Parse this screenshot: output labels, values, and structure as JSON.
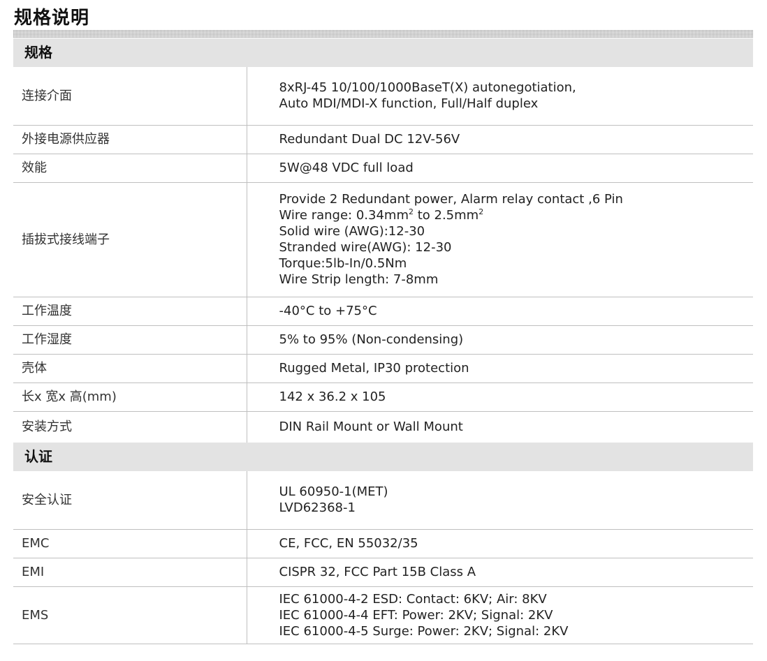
{
  "page_title": "规格说明",
  "sections": {
    "spec": {
      "title": "规格",
      "rows": [
        {
          "label": "连接介面",
          "lines": [
            "8xRJ-45 10/100/1000BaseT(X) autonegotiation,",
            "Auto MDI/MDI-X function, Full/Half duplex"
          ]
        },
        {
          "label": "外接电源供应器",
          "lines": [
            "Redundant Dual DC 12V-56V"
          ]
        },
        {
          "label": "效能",
          "lines": [
            "5W@48 VDC full load"
          ]
        },
        {
          "label": "插拔式接线端子",
          "lines": [
            "Provide 2 Redundant power, Alarm relay contact ,6 Pin"
          ],
          "wire_range": {
            "prefix": "Wire range: 0.34mm",
            "sup1": "2",
            "middle": " to 2.5mm",
            "sup2": "2"
          },
          "more_lines": [
            "Solid wire (AWG):12-30",
            "Stranded wire(AWG): 12-30",
            "Torque:5lb-In/0.5Nm",
            "Wire Strip length: 7-8mm"
          ]
        },
        {
          "label": "工作温度",
          "lines": [
            "-40°C to +75°C"
          ]
        },
        {
          "label": "工作湿度",
          "lines": [
            "5% to 95% (Non-condensing)"
          ]
        },
        {
          "label": "壳体",
          "lines": [
            "Rugged Metal, IP30 protection"
          ]
        },
        {
          "label": "长x 宽x 高(mm)",
          "lines": [
            "142 x 36.2 x 105"
          ]
        },
        {
          "label": "安装方式",
          "lines": [
            "DIN Rail Mount or Wall Mount"
          ]
        }
      ]
    },
    "cert": {
      "title": "认证",
      "rows": [
        {
          "label": "安全认证",
          "lines": [
            "UL 60950-1(MET)",
            "LVD62368-1"
          ]
        },
        {
          "label": "EMC",
          "lines": [
            "CE, FCC, EN 55032/35"
          ]
        },
        {
          "label": "EMI",
          "lines": [
            "CISPR 32, FCC Part 15B Class A"
          ]
        },
        {
          "label": "EMS",
          "lines": [
            "IEC 61000-4-2 ESD: Contact: 6KV; Air: 8KV",
            "IEC 61000-4-4 EFT: Power: 2KV; Signal: 2KV",
            "IEC 61000-4-5 Surge: Power: 2KV; Signal: 2KV"
          ]
        }
      ]
    }
  }
}
